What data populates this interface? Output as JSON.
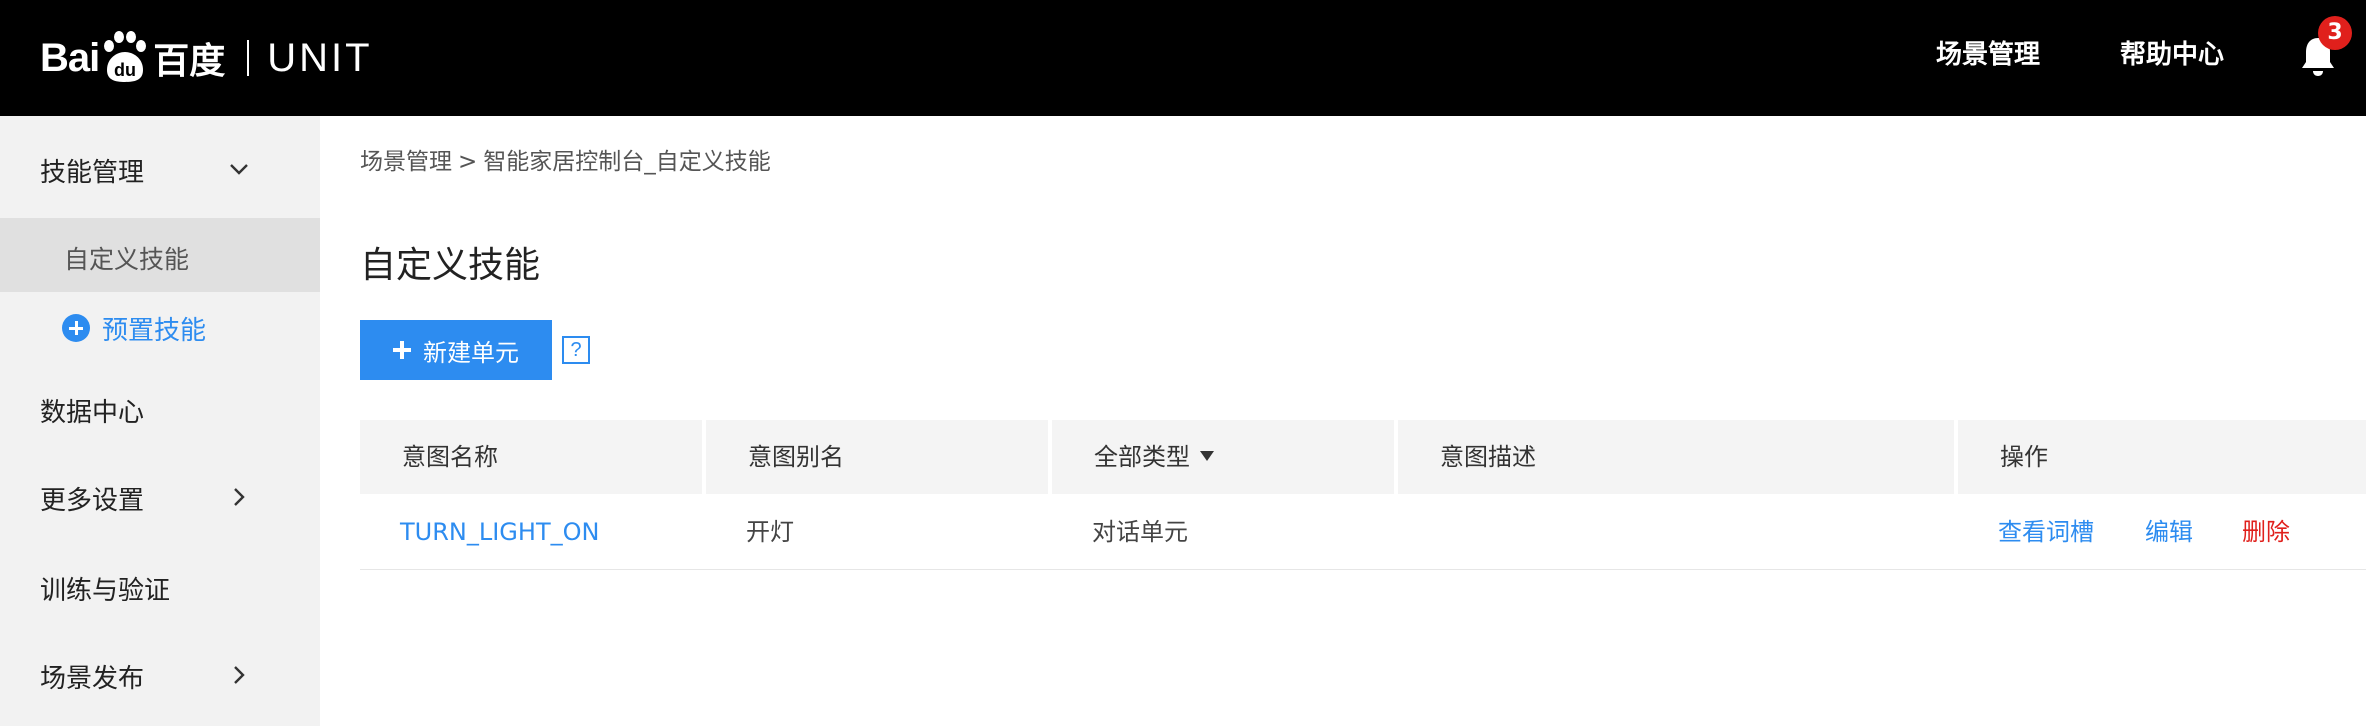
{
  "header": {
    "logo_bai": "Bai",
    "logo_du": "du",
    "logo_cn": "百度",
    "logo_product": "UNIT",
    "nav": [
      "场景管理",
      "帮助中心"
    ],
    "notification_count": "3"
  },
  "sidebar": {
    "skill_management": "技能管理",
    "custom_skill": "自定义技能",
    "preset_skill": "预置技能",
    "data_center": "数据中心",
    "more_settings": "更多设置",
    "train_validate": "训练与验证",
    "scene_publish": "场景发布"
  },
  "breadcrumb": {
    "root": "场景管理",
    "separator": ">",
    "current": "智能家居控制台_自定义技能"
  },
  "page_title": "自定义技能",
  "toolbar": {
    "new_unit_label": "新建单元",
    "help_label": "?"
  },
  "table": {
    "headers": [
      "意图名称",
      "意图别名",
      "全部类型",
      "意图描述",
      "操作"
    ],
    "rows": [
      {
        "name": "TURN_LIGHT_ON",
        "alias": "开灯",
        "type": "对话单元",
        "description": "",
        "actions": [
          "查看词槽",
          "编辑",
          "删除"
        ]
      }
    ]
  },
  "colors": {
    "topbar": "#000000",
    "accent": "#2d8cf0",
    "danger": "#e0201c",
    "sidebar_bg": "#f2f2f2",
    "sidebar_active": "#e0e0e0"
  }
}
